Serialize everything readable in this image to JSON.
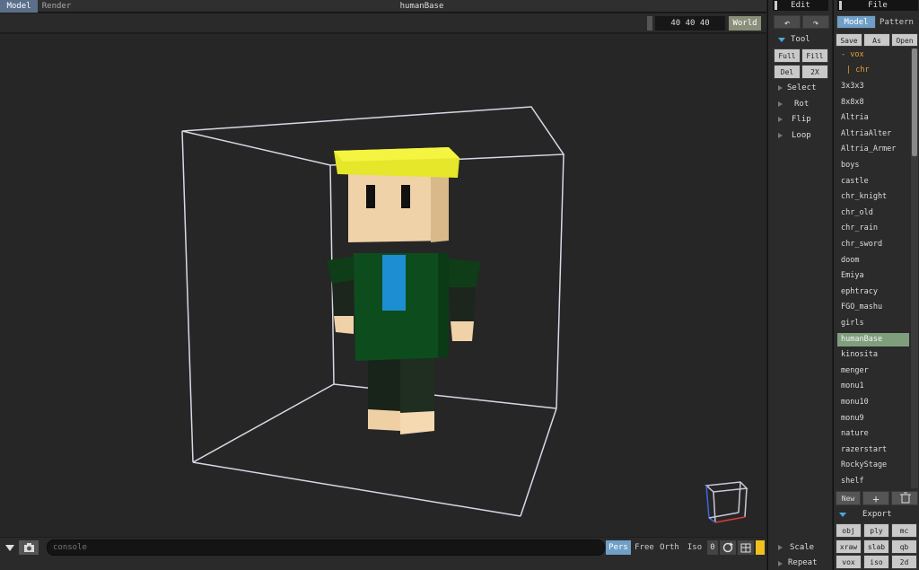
{
  "tabs": [
    {
      "label": "Model",
      "active": true
    },
    {
      "label": "Render",
      "active": false
    }
  ],
  "title": "humanBase",
  "viewport": {
    "dims": "40 40 40",
    "world_label": "World"
  },
  "edit_panel": {
    "header": "Edit",
    "undo_icon": "undo-icon",
    "redo_icon": "redo-icon",
    "tool_label": "Tool",
    "tool_buttons": [
      "Full",
      "Fill",
      "Del",
      "2X"
    ],
    "sections": [
      "Select",
      "Rot",
      "Flip",
      "Loop"
    ],
    "bottom_sections": [
      "Scale",
      "Repeat"
    ]
  },
  "file_panel": {
    "header": "File",
    "tabs": [
      {
        "label": "Model",
        "active": true
      },
      {
        "label": "Pattern",
        "active": false
      }
    ],
    "actions": [
      "Save",
      "As",
      "Open"
    ],
    "tree_root": "- vox",
    "tree_child": "| chr",
    "files": [
      "3x3x3",
      "8x8x8",
      "Altria",
      "AltriaAlter",
      "Altria_Armer",
      "boys",
      "castle",
      "chr_knight",
      "chr_old",
      "chr_rain",
      "chr_sword",
      "doom",
      "Emiya",
      "ephtracy",
      "FGO_mashu",
      "girls",
      "humanBase",
      "kinosita",
      "menger",
      "monu1",
      "monu10",
      "monu9",
      "nature",
      "razerstart",
      "RockyStage",
      "shelf"
    ],
    "selected": "humanBase",
    "new_label": "New",
    "add_icon": "+",
    "export_label": "Export",
    "export_buttons": [
      "obj",
      "ply",
      "mc",
      "xraw",
      "slab",
      "qb",
      "vox",
      "iso",
      "2d"
    ]
  },
  "bottom": {
    "console_placeholder": "console",
    "view_modes": [
      {
        "label": "Pers",
        "active": true
      },
      {
        "label": "Free",
        "active": false
      },
      {
        "label": "Orth",
        "active": false
      },
      {
        "label": "Iso",
        "active": false
      }
    ],
    "zero_label": "0"
  },
  "colors": {
    "accent_blue": "#6f9fc7",
    "selection_green": "#7f9f7c",
    "hair_yellow": "#e6e62a",
    "shirt_green": "#0d4d1d",
    "tie_blue": "#1e8ed2",
    "skin": "#f0d2a8",
    "pants": "#1c2a1c"
  }
}
